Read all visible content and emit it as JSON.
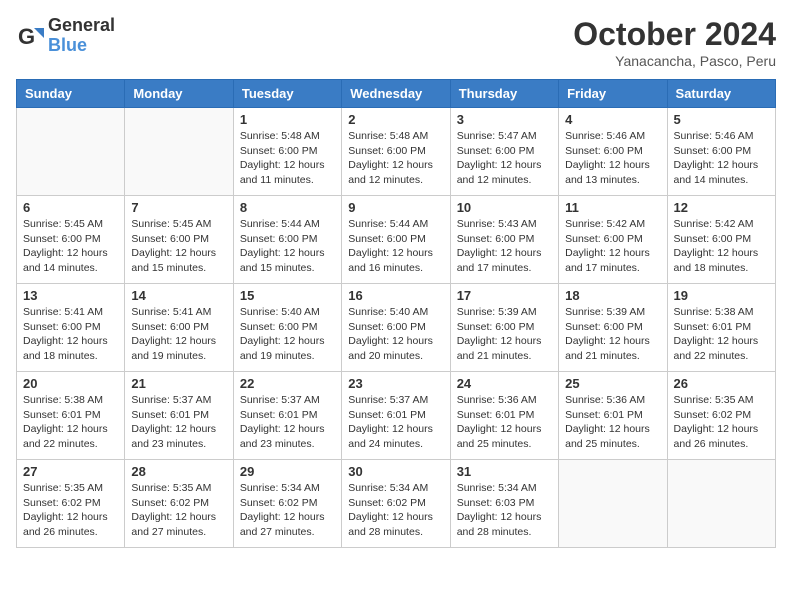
{
  "logo": {
    "line1": "General",
    "line2": "Blue"
  },
  "title": "October 2024",
  "subtitle": "Yanacancha, Pasco, Peru",
  "weekdays": [
    "Sunday",
    "Monday",
    "Tuesday",
    "Wednesday",
    "Thursday",
    "Friday",
    "Saturday"
  ],
  "weeks": [
    [
      {
        "day": "",
        "info": ""
      },
      {
        "day": "",
        "info": ""
      },
      {
        "day": "1",
        "info": "Sunrise: 5:48 AM\nSunset: 6:00 PM\nDaylight: 12 hours\nand 11 minutes."
      },
      {
        "day": "2",
        "info": "Sunrise: 5:48 AM\nSunset: 6:00 PM\nDaylight: 12 hours\nand 12 minutes."
      },
      {
        "day": "3",
        "info": "Sunrise: 5:47 AM\nSunset: 6:00 PM\nDaylight: 12 hours\nand 12 minutes."
      },
      {
        "day": "4",
        "info": "Sunrise: 5:46 AM\nSunset: 6:00 PM\nDaylight: 12 hours\nand 13 minutes."
      },
      {
        "day": "5",
        "info": "Sunrise: 5:46 AM\nSunset: 6:00 PM\nDaylight: 12 hours\nand 14 minutes."
      }
    ],
    [
      {
        "day": "6",
        "info": "Sunrise: 5:45 AM\nSunset: 6:00 PM\nDaylight: 12 hours\nand 14 minutes."
      },
      {
        "day": "7",
        "info": "Sunrise: 5:45 AM\nSunset: 6:00 PM\nDaylight: 12 hours\nand 15 minutes."
      },
      {
        "day": "8",
        "info": "Sunrise: 5:44 AM\nSunset: 6:00 PM\nDaylight: 12 hours\nand 15 minutes."
      },
      {
        "day": "9",
        "info": "Sunrise: 5:44 AM\nSunset: 6:00 PM\nDaylight: 12 hours\nand 16 minutes."
      },
      {
        "day": "10",
        "info": "Sunrise: 5:43 AM\nSunset: 6:00 PM\nDaylight: 12 hours\nand 17 minutes."
      },
      {
        "day": "11",
        "info": "Sunrise: 5:42 AM\nSunset: 6:00 PM\nDaylight: 12 hours\nand 17 minutes."
      },
      {
        "day": "12",
        "info": "Sunrise: 5:42 AM\nSunset: 6:00 PM\nDaylight: 12 hours\nand 18 minutes."
      }
    ],
    [
      {
        "day": "13",
        "info": "Sunrise: 5:41 AM\nSunset: 6:00 PM\nDaylight: 12 hours\nand 18 minutes."
      },
      {
        "day": "14",
        "info": "Sunrise: 5:41 AM\nSunset: 6:00 PM\nDaylight: 12 hours\nand 19 minutes."
      },
      {
        "day": "15",
        "info": "Sunrise: 5:40 AM\nSunset: 6:00 PM\nDaylight: 12 hours\nand 19 minutes."
      },
      {
        "day": "16",
        "info": "Sunrise: 5:40 AM\nSunset: 6:00 PM\nDaylight: 12 hours\nand 20 minutes."
      },
      {
        "day": "17",
        "info": "Sunrise: 5:39 AM\nSunset: 6:00 PM\nDaylight: 12 hours\nand 21 minutes."
      },
      {
        "day": "18",
        "info": "Sunrise: 5:39 AM\nSunset: 6:00 PM\nDaylight: 12 hours\nand 21 minutes."
      },
      {
        "day": "19",
        "info": "Sunrise: 5:38 AM\nSunset: 6:01 PM\nDaylight: 12 hours\nand 22 minutes."
      }
    ],
    [
      {
        "day": "20",
        "info": "Sunrise: 5:38 AM\nSunset: 6:01 PM\nDaylight: 12 hours\nand 22 minutes."
      },
      {
        "day": "21",
        "info": "Sunrise: 5:37 AM\nSunset: 6:01 PM\nDaylight: 12 hours\nand 23 minutes."
      },
      {
        "day": "22",
        "info": "Sunrise: 5:37 AM\nSunset: 6:01 PM\nDaylight: 12 hours\nand 23 minutes."
      },
      {
        "day": "23",
        "info": "Sunrise: 5:37 AM\nSunset: 6:01 PM\nDaylight: 12 hours\nand 24 minutes."
      },
      {
        "day": "24",
        "info": "Sunrise: 5:36 AM\nSunset: 6:01 PM\nDaylight: 12 hours\nand 25 minutes."
      },
      {
        "day": "25",
        "info": "Sunrise: 5:36 AM\nSunset: 6:01 PM\nDaylight: 12 hours\nand 25 minutes."
      },
      {
        "day": "26",
        "info": "Sunrise: 5:35 AM\nSunset: 6:02 PM\nDaylight: 12 hours\nand 26 minutes."
      }
    ],
    [
      {
        "day": "27",
        "info": "Sunrise: 5:35 AM\nSunset: 6:02 PM\nDaylight: 12 hours\nand 26 minutes."
      },
      {
        "day": "28",
        "info": "Sunrise: 5:35 AM\nSunset: 6:02 PM\nDaylight: 12 hours\nand 27 minutes."
      },
      {
        "day": "29",
        "info": "Sunrise: 5:34 AM\nSunset: 6:02 PM\nDaylight: 12 hours\nand 27 minutes."
      },
      {
        "day": "30",
        "info": "Sunrise: 5:34 AM\nSunset: 6:02 PM\nDaylight: 12 hours\nand 28 minutes."
      },
      {
        "day": "31",
        "info": "Sunrise: 5:34 AM\nSunset: 6:03 PM\nDaylight: 12 hours\nand 28 minutes."
      },
      {
        "day": "",
        "info": ""
      },
      {
        "day": "",
        "info": ""
      }
    ]
  ]
}
